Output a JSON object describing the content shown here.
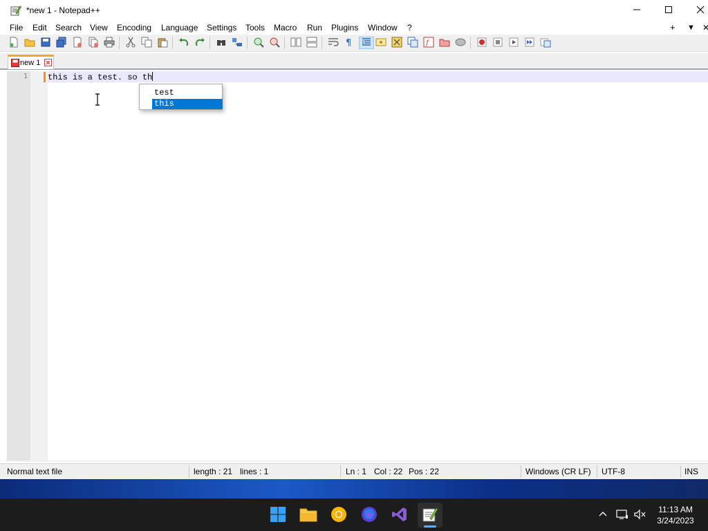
{
  "window": {
    "title": "*new 1 - Notepad++",
    "controls": {
      "minimize": "minimize",
      "maximize": "maximize",
      "close": "close"
    }
  },
  "menu": {
    "items": [
      "File",
      "Edit",
      "Search",
      "View",
      "Encoding",
      "Language",
      "Settings",
      "Tools",
      "Macro",
      "Run",
      "Plugins",
      "Window",
      "?"
    ],
    "right": {
      "plus": "+",
      "down": "▼",
      "close": "✕"
    }
  },
  "toolbar": {
    "buttons": [
      "new-file",
      "open",
      "save",
      "save-all",
      "close",
      "close-all",
      "print",
      "cut",
      "copy",
      "paste",
      "undo",
      "redo",
      "find",
      "replace",
      "zoom-in",
      "zoom-out",
      "sync-vertical",
      "sync-horizontal",
      "word-wrap",
      "show-all-characters",
      "indent-guide",
      "user-defined-language",
      "document-map",
      "function-list",
      "folder-as-workspace",
      "monitoring",
      "record-macro",
      "stop-recording",
      "playback-macro",
      "run-macro-multiple",
      "save-macro"
    ]
  },
  "tabs": [
    {
      "label": "new 1",
      "modified": true,
      "active": true
    }
  ],
  "editor": {
    "line_numbers": [
      "1"
    ],
    "lines": [
      "this is a test. so th"
    ],
    "autocomplete": {
      "items": [
        "test",
        "this"
      ],
      "selected_index": 1
    }
  },
  "status": {
    "file_type": "Normal text file",
    "length": "length : 21",
    "lines": "lines : 1",
    "ln": "Ln : 1",
    "col": "Col : 22",
    "pos": "Pos : 22",
    "eol": "Windows (CR LF)",
    "encoding": "UTF-8",
    "mode": "INS"
  },
  "taskbar": {
    "apps": [
      "windows-start",
      "file-explorer",
      "chrome-canary",
      "firefox",
      "visual-studio",
      "notepad-plus-plus"
    ],
    "active_app": "notepad-plus-plus",
    "clock_time": "11:13 AM",
    "clock_date": "3/24/2023"
  },
  "colors": {
    "accent": "#0078d7",
    "tab_highlight": "#f5a623",
    "current_line": "#e8e8ff"
  }
}
